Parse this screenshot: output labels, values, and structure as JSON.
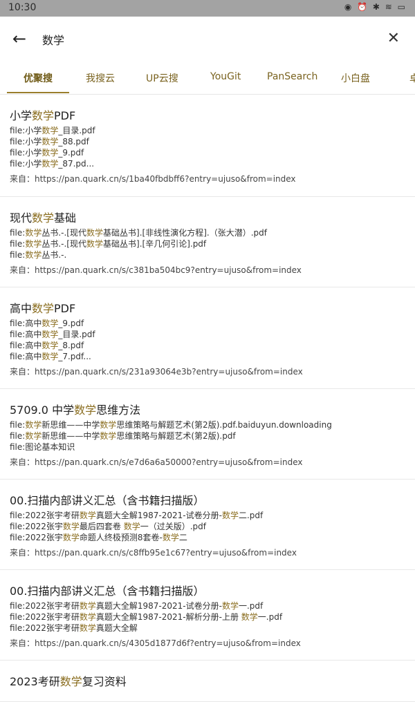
{
  "statusbar": {
    "time": "10:30",
    "icons_text": "◉ ⏰ ✱ ≋ ▭"
  },
  "search": {
    "back_icon": "←",
    "query": "数学",
    "clear_icon": "✕"
  },
  "tabs": [
    {
      "label": "优聚搜",
      "active": true
    },
    {
      "label": "我搜云",
      "active": false
    },
    {
      "label": "UP云搜",
      "active": false
    },
    {
      "label": "YouGit",
      "active": false
    },
    {
      "label": "PanSearch",
      "active": false
    },
    {
      "label": "小白盘",
      "active": false
    },
    {
      "label": "卓",
      "active": false
    }
  ],
  "highlight_term": "数学",
  "results": [
    {
      "title": "小学数学PDF",
      "files": [
        "file:小学数学_目录.pdf",
        "file:小学数学_88.pdf",
        "file:小学数学_9.pdf",
        "file:小学数学_87.pd..."
      ],
      "source": "来自：https://pan.quark.cn/s/1ba40fbdbff6?entry=ujuso&from=index"
    },
    {
      "title": "现代数学基础",
      "files": [
        "file:数学丛书.-.[现代数学基础丛书].[非线性演化方程].（张大潜）.pdf",
        "file:数学丛书.-.[现代数学基础丛书].[辛几何引论].pdf",
        "file:数学丛书.-."
      ],
      "source": "来自：https://pan.quark.cn/s/c381ba504bc9?entry=ujuso&from=index"
    },
    {
      "title": "高中数学PDF",
      "files": [
        "file:高中数学_9.pdf",
        "file:高中数学_目录.pdf",
        "file:高中数学_8.pdf",
        "file:高中数学_7.pdf..."
      ],
      "source": "来自：https://pan.quark.cn/s/231a93064e3b?entry=ujuso&from=index"
    },
    {
      "title": "5709.0 中学数学思维方法",
      "files": [
        "file:数学新思维——中学数学思维策略与解题艺术(第2版).pdf.baiduyun.downloading",
        "file:数学新思维——中学数学思维策略与解题艺术(第2版).pdf",
        "file:图论基本知识"
      ],
      "source": "来自：https://pan.quark.cn/s/e7d6a6a50000?entry=ujuso&from=index"
    },
    {
      "title": "00.扫描内部讲义汇总（含书籍扫描版）",
      "files": [
        "file:2022张宇考研数学真题大全解1987-2021-试卷分册-数学二.pdf",
        "file:2022张宇数学最后四套卷 数学一（过关版）.pdf",
        "file:2022张宇数学命题人终极预测8套卷-数学二"
      ],
      "source": "来自：https://pan.quark.cn/s/c8ffb95e1c67?entry=ujuso&from=index"
    },
    {
      "title": "00.扫描内部讲义汇总（含书籍扫描版）",
      "files": [
        "file:2022张宇考研数学真题大全解1987-2021-试卷分册-数学一.pdf",
        "file:2022张宇考研数学真题大全解1987-2021-解析分册-上册 数学一.pdf",
        "file:2022张宇考研数学真题大全解"
      ],
      "source": "来自：https://pan.quark.cn/s/4305d1877d6f?entry=ujuso&from=index"
    },
    {
      "title": "2023考研数学复习资料",
      "files": [],
      "source": ""
    }
  ]
}
